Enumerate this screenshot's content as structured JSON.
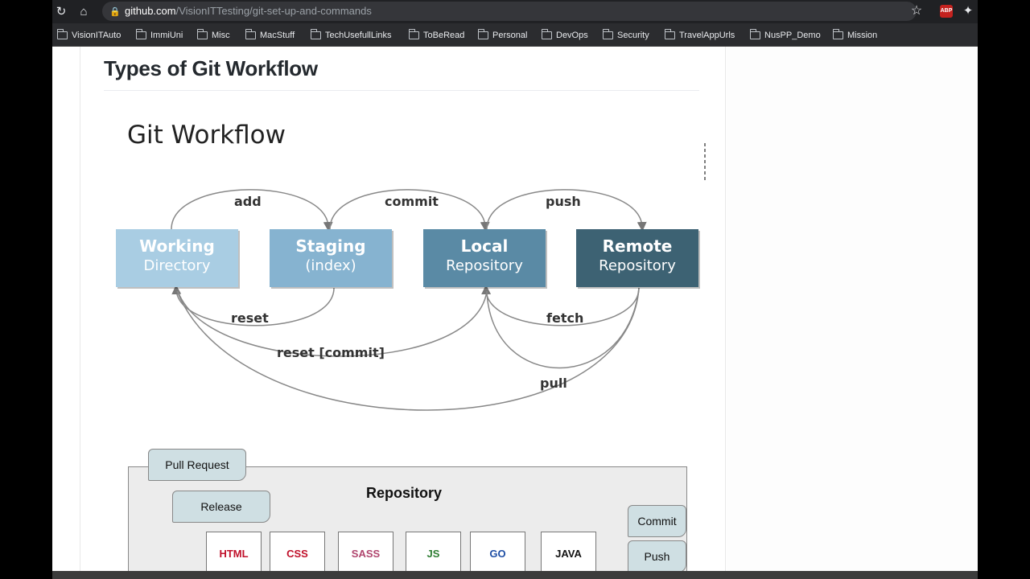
{
  "browser": {
    "url_domain": "github.com",
    "url_path": "/VisionITTesting/git-set-up-and-commands",
    "bookmarks": [
      "VisionITAuto",
      "ImmiUni",
      "Misc",
      "MacStuff",
      "TechUsefullLinks",
      "ToBeRead",
      "Personal",
      "DevOps",
      "Security",
      "TravelAppUrls",
      "NusPP_Demo",
      "Mission"
    ],
    "abp_badge": "ABP"
  },
  "page": {
    "heading": "Types of Git Workflow"
  },
  "workflow_figure": {
    "title": "Git Workflow",
    "boxes": [
      {
        "title": "Working",
        "subtitle": "Directory",
        "color": "#a9cde3"
      },
      {
        "title": "Staging",
        "subtitle": "(index)",
        "color": "#86b3d0"
      },
      {
        "title": "Local",
        "subtitle": "Repository",
        "color": "#5a8aa5"
      },
      {
        "title": "Remote",
        "subtitle": "Repository",
        "color": "#3d6273"
      }
    ],
    "labels": {
      "add": "add",
      "commit": "commit",
      "push": "push",
      "reset": "reset",
      "reset_commit": "reset [commit]",
      "fetch": "fetch",
      "pull": "pull"
    }
  },
  "repo_figure": {
    "title": "Repository",
    "left_tags": [
      "Pull Request",
      "Release"
    ],
    "right_tags": [
      "Commit",
      "Push"
    ],
    "languages": [
      {
        "name": "HTML",
        "color": "#c0102a"
      },
      {
        "name": "CSS",
        "color": "#c0102a"
      },
      {
        "name": "SASS",
        "color": "#b0466e"
      },
      {
        "name": "JS",
        "color": "#2e7d32"
      },
      {
        "name": "GO",
        "color": "#1f4fa5"
      },
      {
        "name": "JAVA",
        "color": "#111111"
      }
    ]
  }
}
